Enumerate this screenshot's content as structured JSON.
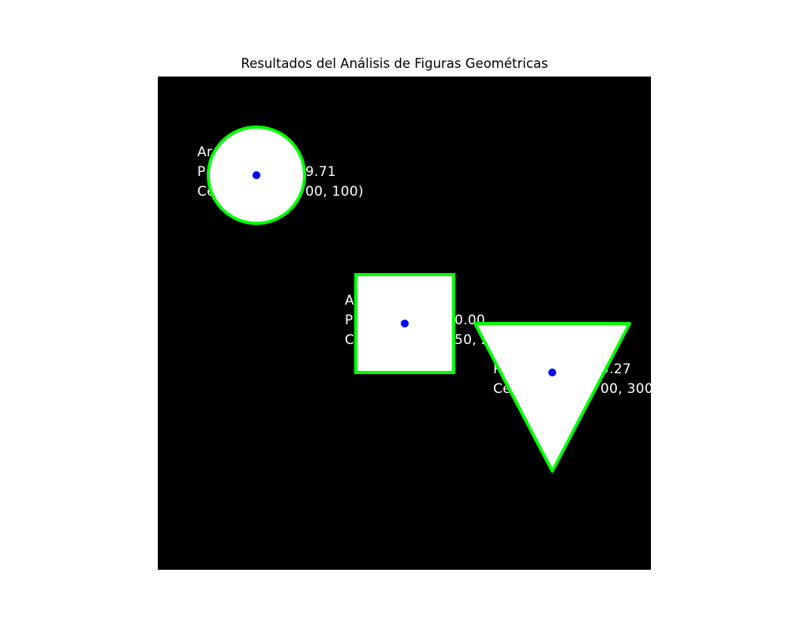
{
  "title": "Resultados del Análisis de Figuras Geométricas",
  "colors": {
    "background": "#000000",
    "shape_fill": "#ffffff",
    "contour": "#00ff00",
    "centroid": "#0000ff",
    "text": "#ffffff"
  },
  "shapes": [
    {
      "id": "circle",
      "type": "circle",
      "label_lines": [
        "Ar",
        "P",
        "9.71",
        "Ce",
        "00, 100)"
      ]
    },
    {
      "id": "square",
      "type": "square",
      "label_lines": [
        "A",
        "P",
        "0.00",
        "C",
        "50, 2"
      ]
    },
    {
      "id": "triangle",
      "type": "triangle",
      "label_lines": [
        "P",
        "5.27",
        "Ce",
        "00, 300"
      ]
    }
  ]
}
